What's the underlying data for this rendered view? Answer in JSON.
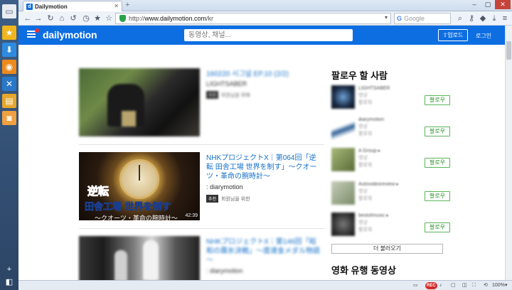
{
  "dock": {
    "items": [
      {
        "name": "window-icon",
        "glyph": "▭",
        "bg": "#e8ecf1"
      },
      {
        "name": "star-icon",
        "glyph": "★",
        "bg": "#f1b61e"
      },
      {
        "name": "download-icon",
        "glyph": "⬇",
        "bg": "#2f8be0"
      },
      {
        "name": "rss-icon",
        "glyph": "◉",
        "bg": "#ee8a1c"
      },
      {
        "name": "tools-icon",
        "glyph": "✕",
        "bg": "#2a78c8"
      },
      {
        "name": "notes-icon",
        "glyph": "▤",
        "bg": "#e7a72a"
      },
      {
        "name": "camera-icon",
        "glyph": "◙",
        "bg": "#f0a040"
      }
    ],
    "add_glyph": "+",
    "bottom_glyph": "◧"
  },
  "browser": {
    "tab_title": "Dailymotion",
    "tab_favicon": "d",
    "tab_close": "✕",
    "new_tab_glyph": "+",
    "url_prefix": "http://",
    "url_host": "www.dailymotion.com",
    "url_path": "/kr",
    "search_placeholder": "Google",
    "window_controls": {
      "minimize": "–",
      "maximize": "▢",
      "close": "✕"
    }
  },
  "header": {
    "logo": "dailymotion",
    "search_placeholder": "동영상, 채널...",
    "upload_label": "⇧업로드",
    "login_label": "로그인"
  },
  "videos": [
    {
      "title": "160220 시그널 EP.10 (2/2)",
      "channel": "LIGHTSABER",
      "tag": "추천",
      "meta": "회원님을 위해",
      "duration": "",
      "blurred": true
    },
    {
      "title": "NHKプロジェクトX｜第064回「逆転 田舎工場 世界を制す」～クオーツ・革命の腕時計～",
      "channel": ": diarymotion",
      "tag": "추천",
      "meta": "회원님을 위한",
      "duration": "42:39",
      "blurred": false,
      "thumb_big": "逆転",
      "thumb_line": "田舎工場 世界を制す",
      "thumb_sub": "～クオーツ・革命の腕時計～"
    },
    {
      "title": "NHKプロジェクトX｜第146回「昭和の霧氷決戦」～度達金メダル物語～",
      "channel": ": diarymotion",
      "tag": "",
      "meta": "",
      "duration": "",
      "blurred": true
    }
  ],
  "sidebar": {
    "follow_title": "팔로우 할 사람",
    "follow_label": "팔로우",
    "people": [
      {
        "name": "LIGHTSABER",
        "line1": "영상",
        "line2": "팔로워",
        "av": "#1a2b44"
      },
      {
        "name": "diarymotion",
        "line1": "영상",
        "line2": "팔로워",
        "av": "#2c5f95"
      },
      {
        "name": "A Group ▸",
        "line1": "영상",
        "line2": "팔로워",
        "av": "#7d8f52"
      },
      {
        "name": "Autovideoreview ▸",
        "line1": "영상",
        "line2": "팔로워",
        "av": "#8a9a78"
      },
      {
        "name": "bestofmusic ▸",
        "line1": "영상",
        "line2": "팔로워",
        "av": "#353535"
      }
    ],
    "more_label": "더 불러오기",
    "trending_title": "영화 유행 동영상"
  },
  "status": {
    "zoom": "100%",
    "rec": "REC",
    "icons": [
      "monitor-icon",
      "fullscreen-icon",
      "speaker-icon"
    ]
  },
  "colors": {
    "brand": "#0d6ee2",
    "follow_green": "#5ab45a",
    "link": "#1470c8"
  }
}
